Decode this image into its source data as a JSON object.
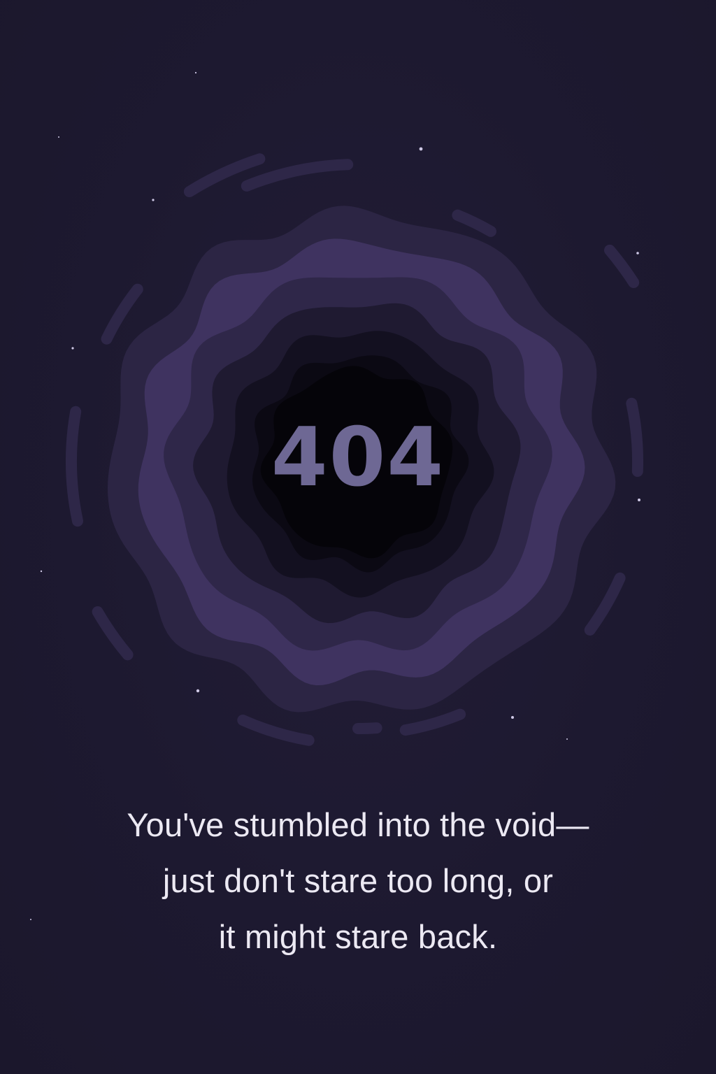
{
  "error": {
    "code": "404"
  },
  "message": {
    "lines": [
      "You've stumbled into the void—",
      "just don't stare too long, or",
      "it might stare back."
    ]
  },
  "colors": {
    "background": "#1e1a2f",
    "ring_light": "#3f3360",
    "void_center": "#050409",
    "code_text": "#6e6894",
    "message_text": "#ece9f3"
  }
}
